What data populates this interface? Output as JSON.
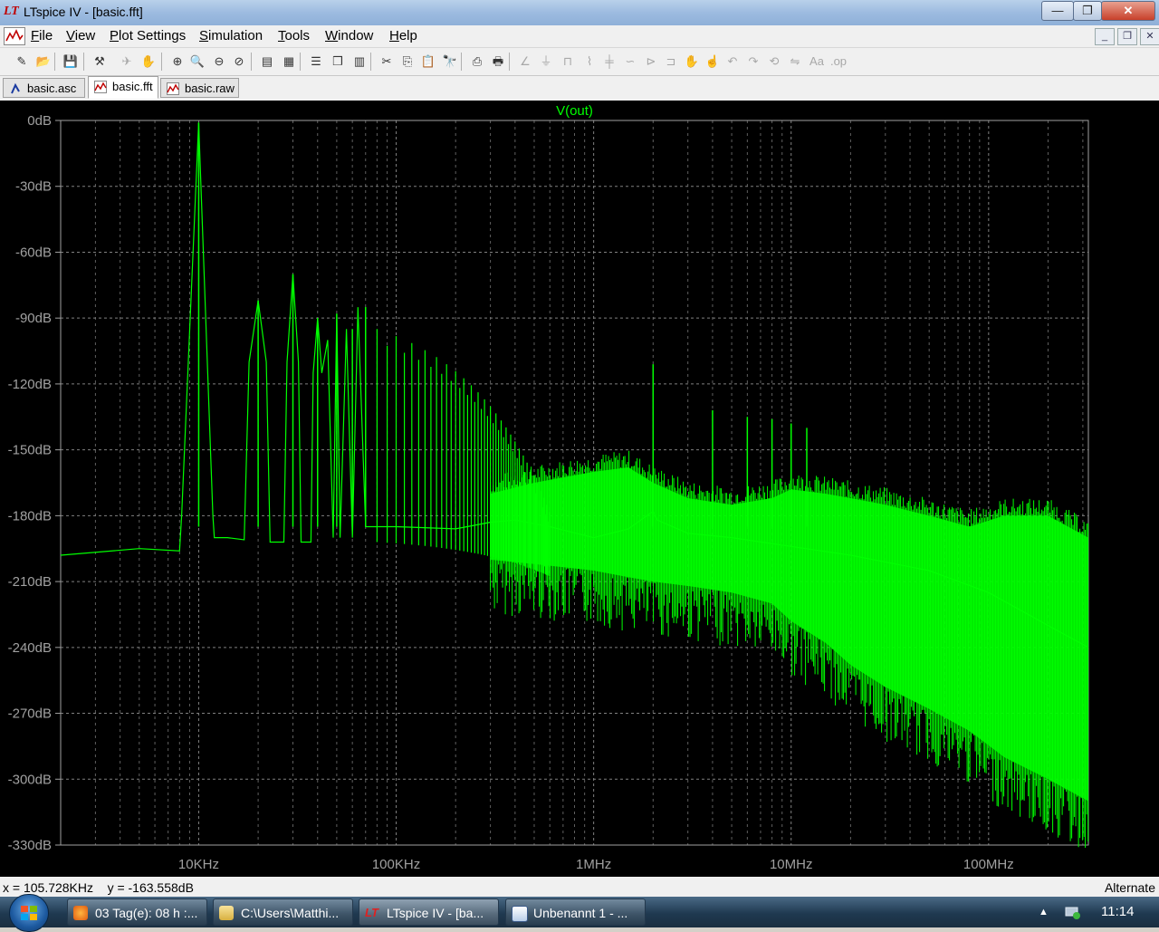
{
  "window": {
    "title": "LTspice IV - [basic.fft]",
    "app_icon": "LT"
  },
  "window_buttons": {
    "minimize_label": "—",
    "maximize_label": "❐",
    "close_label": "✕"
  },
  "menu": {
    "items": [
      {
        "label": "File",
        "mnemonic": "F"
      },
      {
        "label": "View",
        "mnemonic": "V"
      },
      {
        "label": "Plot Settings",
        "mnemonic": "P"
      },
      {
        "label": "Simulation",
        "mnemonic": "S"
      },
      {
        "label": "Tools",
        "mnemonic": "T"
      },
      {
        "label": "Window",
        "mnemonic": "W"
      },
      {
        "label": "Help",
        "mnemonic": "H"
      }
    ],
    "mdi_minimize_label": "_",
    "mdi_restore_label": "❐",
    "mdi_close_label": "✕"
  },
  "toolbar": {
    "icons": [
      {
        "name": "new-schematic-icon",
        "glyph": "✎",
        "enabled": true
      },
      {
        "name": "open-icon",
        "glyph": "📂",
        "enabled": true
      },
      {
        "name": "save-icon",
        "glyph": "💾",
        "enabled": true
      },
      {
        "name": "control-panel-icon",
        "glyph": "⚒",
        "enabled": true
      },
      {
        "name": "run-icon",
        "glyph": "✈",
        "enabled": false
      },
      {
        "name": "pan-icon",
        "glyph": "✋",
        "enabled": false
      },
      {
        "name": "zoom-in-icon",
        "glyph": "⊕",
        "enabled": true
      },
      {
        "name": "zoom-area-icon",
        "glyph": "🔍",
        "enabled": true
      },
      {
        "name": "zoom-out-icon",
        "glyph": "⊖",
        "enabled": true
      },
      {
        "name": "zoom-cancel-icon",
        "glyph": "⊘",
        "enabled": true
      },
      {
        "name": "autorange-icon",
        "glyph": "▤",
        "enabled": true
      },
      {
        "name": "grid-icon",
        "glyph": "▦",
        "enabled": true
      },
      {
        "name": "tile-horizontal-icon",
        "glyph": "☰",
        "enabled": true
      },
      {
        "name": "cascade-icon",
        "glyph": "❒",
        "enabled": true
      },
      {
        "name": "tile-vertical-icon",
        "glyph": "▥",
        "enabled": true
      },
      {
        "name": "cut-icon",
        "glyph": "✂",
        "enabled": true
      },
      {
        "name": "copy-icon",
        "glyph": "⎘",
        "enabled": true
      },
      {
        "name": "paste-icon",
        "glyph": "📋",
        "enabled": true
      },
      {
        "name": "find-icon",
        "glyph": "🔭",
        "enabled": true
      },
      {
        "name": "print-preview-icon",
        "glyph": "⎙",
        "enabled": true
      },
      {
        "name": "print-icon",
        "glyph": "🖶",
        "enabled": true
      },
      {
        "name": "wire-icon",
        "glyph": "∠",
        "enabled": false
      },
      {
        "name": "ground-icon",
        "glyph": "⏚",
        "enabled": false
      },
      {
        "name": "label-icon",
        "glyph": "⊓",
        "enabled": false
      },
      {
        "name": "resistor-icon",
        "glyph": "⌇",
        "enabled": false
      },
      {
        "name": "capacitor-icon",
        "glyph": "╪",
        "enabled": false
      },
      {
        "name": "inductor-icon",
        "glyph": "∽",
        "enabled": false
      },
      {
        "name": "diode-icon",
        "glyph": "⊳",
        "enabled": false
      },
      {
        "name": "component-icon",
        "glyph": "⊐",
        "enabled": false
      },
      {
        "name": "move-icon",
        "glyph": "✋",
        "enabled": false
      },
      {
        "name": "drag-icon",
        "glyph": "☝",
        "enabled": false
      },
      {
        "name": "undo-icon",
        "glyph": "↶",
        "enabled": false
      },
      {
        "name": "redo-icon",
        "glyph": "↷",
        "enabled": false
      },
      {
        "name": "rotate-icon",
        "glyph": "⟲",
        "enabled": false
      },
      {
        "name": "mirror-icon",
        "glyph": "⇋",
        "enabled": false
      },
      {
        "name": "text-icon",
        "glyph": "Aa",
        "enabled": false
      },
      {
        "name": "spice-directive-icon",
        "glyph": ".op",
        "enabled": false
      }
    ]
  },
  "tabs": [
    {
      "label": "basic.asc",
      "icon": "schematic-icon",
      "active": false
    },
    {
      "label": "basic.fft",
      "icon": "waveform-icon",
      "active": true
    },
    {
      "label": "basic.raw",
      "icon": "waveform-icon",
      "active": false
    }
  ],
  "plot": {
    "background": "#000000",
    "trace_color": "#00ff00",
    "grid_color": "#808080"
  },
  "chart_data": {
    "type": "line",
    "title": "V(out)",
    "xscale": "log",
    "xlim": [
      2000,
      320000000
    ],
    "ylim": [
      -330,
      0
    ],
    "grid": true,
    "x_ticks": [
      10000,
      100000,
      1000000,
      10000000,
      100000000
    ],
    "x_tick_labels": [
      "10KHz",
      "100KHz",
      "1MHz",
      "10MHz",
      "100MHz"
    ],
    "y_ticks": [
      0,
      -30,
      -60,
      -90,
      -120,
      -150,
      -180,
      -210,
      -240,
      -270,
      -300,
      -330
    ],
    "y_tick_labels": [
      "0dB",
      "-30dB",
      "-60dB",
      "-90dB",
      "-120dB",
      "-150dB",
      "-180dB",
      "-210dB",
      "-240dB",
      "-270dB",
      "-300dB",
      "-330dB"
    ],
    "series": [
      {
        "name": "V(out)",
        "x": [
          2000,
          5000,
          8000,
          8200,
          10000,
          11800,
          12000,
          14000,
          17000,
          18000,
          20000,
          22000,
          23000,
          27000,
          28000,
          30000,
          32000,
          33000,
          37000,
          38000,
          40000,
          42000,
          45000,
          48000,
          50000,
          52000,
          56000,
          60000,
          64000,
          70000,
          100000,
          200000,
          300000,
          400000,
          600000,
          1000000,
          1500000,
          2000000,
          2100000,
          3000000,
          5000000,
          10000000,
          20000000,
          50000000,
          100000000,
          200000000,
          320000000
        ],
        "y": [
          -198,
          -195,
          -196,
          -180,
          -1,
          -180,
          -190,
          -190,
          -191,
          -110,
          -82,
          -110,
          -192,
          -192,
          -110,
          -70,
          -110,
          -192,
          -192,
          -115,
          -90,
          -115,
          -100,
          -190,
          -88,
          -190,
          -95,
          -190,
          -85,
          -185,
          -185,
          -186,
          -183,
          -182,
          -185,
          -190,
          -186,
          -178,
          -182,
          -188,
          -190,
          -194,
          -198,
          -205,
          -215,
          -230,
          -240
        ],
        "upper_envelope": [
          -170,
          -165,
          -160,
          -158,
          -165,
          -172,
          -175,
          -172,
          -168,
          -170,
          -172,
          -175,
          -180,
          -185,
          -180,
          -180,
          -190
        ],
        "lower_envelope": [
          -200,
          -202,
          -205,
          -208,
          -210,
          -212,
          -215,
          -220,
          -228,
          -238,
          -248,
          -258,
          -268,
          -278,
          -290,
          -300,
          -310
        ],
        "envelope_x": [
          300000,
          500000,
          1000000,
          1500000,
          2000000,
          3000000,
          5000000,
          8000000,
          10000000,
          15000000,
          20000000,
          30000000,
          50000000,
          80000000,
          120000000,
          200000000,
          320000000
        ]
      }
    ],
    "harmonic_peaks": [
      {
        "x": 10000,
        "y": -1
      },
      {
        "x": 20000,
        "y": -82
      },
      {
        "x": 30000,
        "y": -70
      },
      {
        "x": 40000,
        "y": -90
      },
      {
        "x": 50000,
        "y": -88
      },
      {
        "x": 60000,
        "y": -95
      },
      {
        "x": 70000,
        "y": -85
      },
      {
        "x": 2000000,
        "y": -111
      },
      {
        "x": 4000000,
        "y": -132
      },
      {
        "x": 6000000,
        "y": -135
      },
      {
        "x": 8000000,
        "y": -136
      },
      {
        "x": 10000000,
        "y": -138
      },
      {
        "x": 12000000,
        "y": -140
      }
    ]
  },
  "status": {
    "coords": "x = 105.728KHz    y = -163.558dB",
    "mode": "Alternate"
  },
  "taskbar": {
    "tasks": [
      {
        "label": "03 Tag(e): 08 h :...",
        "icon": "firefox-icon",
        "active": false
      },
      {
        "label": "C:\\Users\\Matthi...",
        "icon": "folder-icon",
        "active": false
      },
      {
        "label": "LTspice IV - [ba...",
        "icon": "ltspice-icon",
        "active": true
      },
      {
        "label": "Unbenannt 1 - ...",
        "icon": "document-icon",
        "active": false
      }
    ],
    "tray_arrow": "▲",
    "clock": "11:14"
  }
}
